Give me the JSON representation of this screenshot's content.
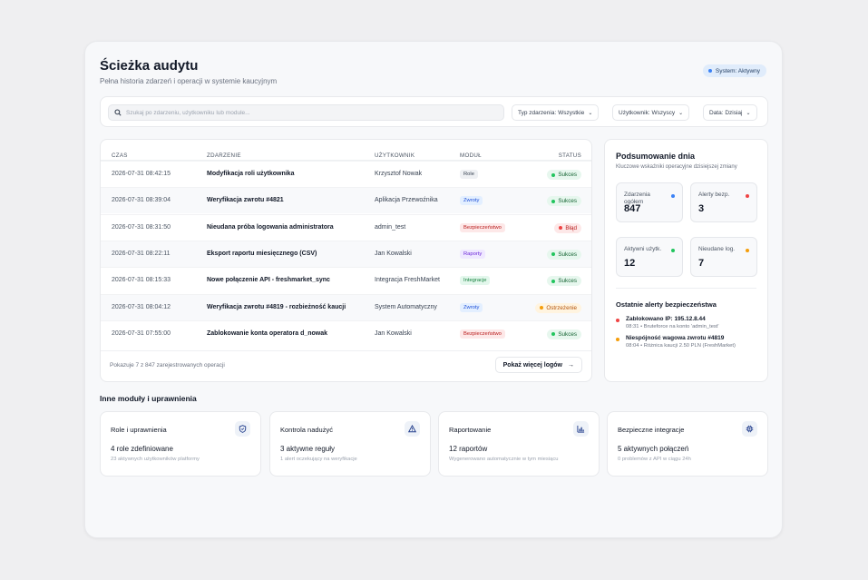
{
  "header": {
    "title": "Ścieżka audytu",
    "subtitle": "Pełna historia zdarzeń i operacji w systemie kaucyjnym",
    "status": "System: Aktywny"
  },
  "filters": {
    "search_placeholder": "Szukaj po zdarzeniu, użytkowniku lub module...",
    "event_type": "Typ zdarzenia: Wszystkie",
    "user": "Użytkownik: Wszyscy",
    "date": "Data: Dzisiaj"
  },
  "table": {
    "headers": {
      "time": "CZAS",
      "event": "ZDARZENIE",
      "user": "UŻYTKOWNIK",
      "module": "MODUŁ",
      "status": "STATUS"
    },
    "rows": [
      {
        "time": "2026-07-31 08:42:15",
        "event": "Modyfikacja roli użytkownika",
        "user": "Krzysztof Nowak",
        "module": "Role",
        "module_style": "gray",
        "status": "Sukces",
        "status_style": "ok"
      },
      {
        "time": "2026-07-31 08:39:04",
        "event": "Weryfikacja zwrotu #4821",
        "user": "Aplikacja Przewoźnika",
        "module": "Zwroty",
        "module_style": "blue",
        "status": "Sukces",
        "status_style": "ok"
      },
      {
        "time": "2026-07-31 08:31:50",
        "event": "Nieudana próba logowania administratora",
        "user": "admin_test",
        "module": "Bezpieczeństwo",
        "module_style": "red",
        "status": "Błąd",
        "status_style": "err"
      },
      {
        "time": "2026-07-31 08:22:11",
        "event": "Eksport raportu miesięcznego (CSV)",
        "user": "Jan Kowalski",
        "module": "Raporty",
        "module_style": "purple",
        "status": "Sukces",
        "status_style": "ok"
      },
      {
        "time": "2026-07-31 08:15:33",
        "event": "Nowe połączenie API - freshmarket_sync",
        "user": "Integracja FreshMarket",
        "module": "Integracje",
        "module_style": "green",
        "status": "Sukces",
        "status_style": "ok"
      },
      {
        "time": "2026-07-31 08:04:12",
        "event": "Weryfikacja zwrotu #4819 - rozbieżność kaucji",
        "user": "System Automatyczny",
        "module": "Zwroty",
        "module_style": "blue",
        "status": "Ostrzeżenie",
        "status_style": "warn"
      },
      {
        "time": "2026-07-31 07:55:00",
        "event": "Zablokowanie konta operatora d_nowak",
        "user": "Jan Kowalski",
        "module": "Bezpieczeństwo",
        "module_style": "red",
        "status": "Sukces",
        "status_style": "ok"
      }
    ],
    "footer_text": "Pokazuje 7 z 847 zarejestrowanych operacji",
    "more_button": "Pokaż więcej logów"
  },
  "summary": {
    "title": "Podsumowanie dnia",
    "subtitle": "Kluczowe wskaźniki operacyjne dzisiejszej zmiany",
    "stats": [
      {
        "label": "Zdarzenia ogółem",
        "value": "847",
        "color": "#3b82f6"
      },
      {
        "label": "Alerty bezp.",
        "value": "3",
        "color": "#ef4444"
      },
      {
        "label": "Aktywni użytk.",
        "value": "12",
        "color": "#22c55e"
      },
      {
        "label": "Nieudane log.",
        "value": "7",
        "color": "#f59e0b"
      }
    ],
    "alerts_title": "Ostatnie alerty bezpieczeństwa",
    "alerts": [
      {
        "title": "Zablokowano IP: 195.12.8.44",
        "meta": "08:31 • Bruteforce na konto 'admin_test'",
        "color": "#ef4444"
      },
      {
        "title": "Niespójność wagowa zwrotu #4819",
        "meta": "08:04 • Różnica kaucji 2.50 PLN (FreshMarket)",
        "color": "#f59e0b"
      }
    ]
  },
  "modules": {
    "title": "Inne moduły i uprawnienia",
    "cards": [
      {
        "title": "Role i uprawnienia",
        "value": "4 role zdefiniowane",
        "desc": "23 aktywnych użytkowników platformy",
        "icon": "shield-icon"
      },
      {
        "title": "Kontrola nadużyć",
        "value": "3 aktywne reguły",
        "desc": "1 alert oczekujący na weryfikacje",
        "icon": "warning-icon"
      },
      {
        "title": "Raportowanie",
        "value": "12 raportów",
        "desc": "Wygenerowano automatycznie w tym miesiącu",
        "icon": "bar-chart-icon"
      },
      {
        "title": "Bezpieczne integracje",
        "value": "5 aktywnych połączeń",
        "desc": "0 problemów z API w ciągu 24h",
        "icon": "chip-icon"
      }
    ]
  }
}
